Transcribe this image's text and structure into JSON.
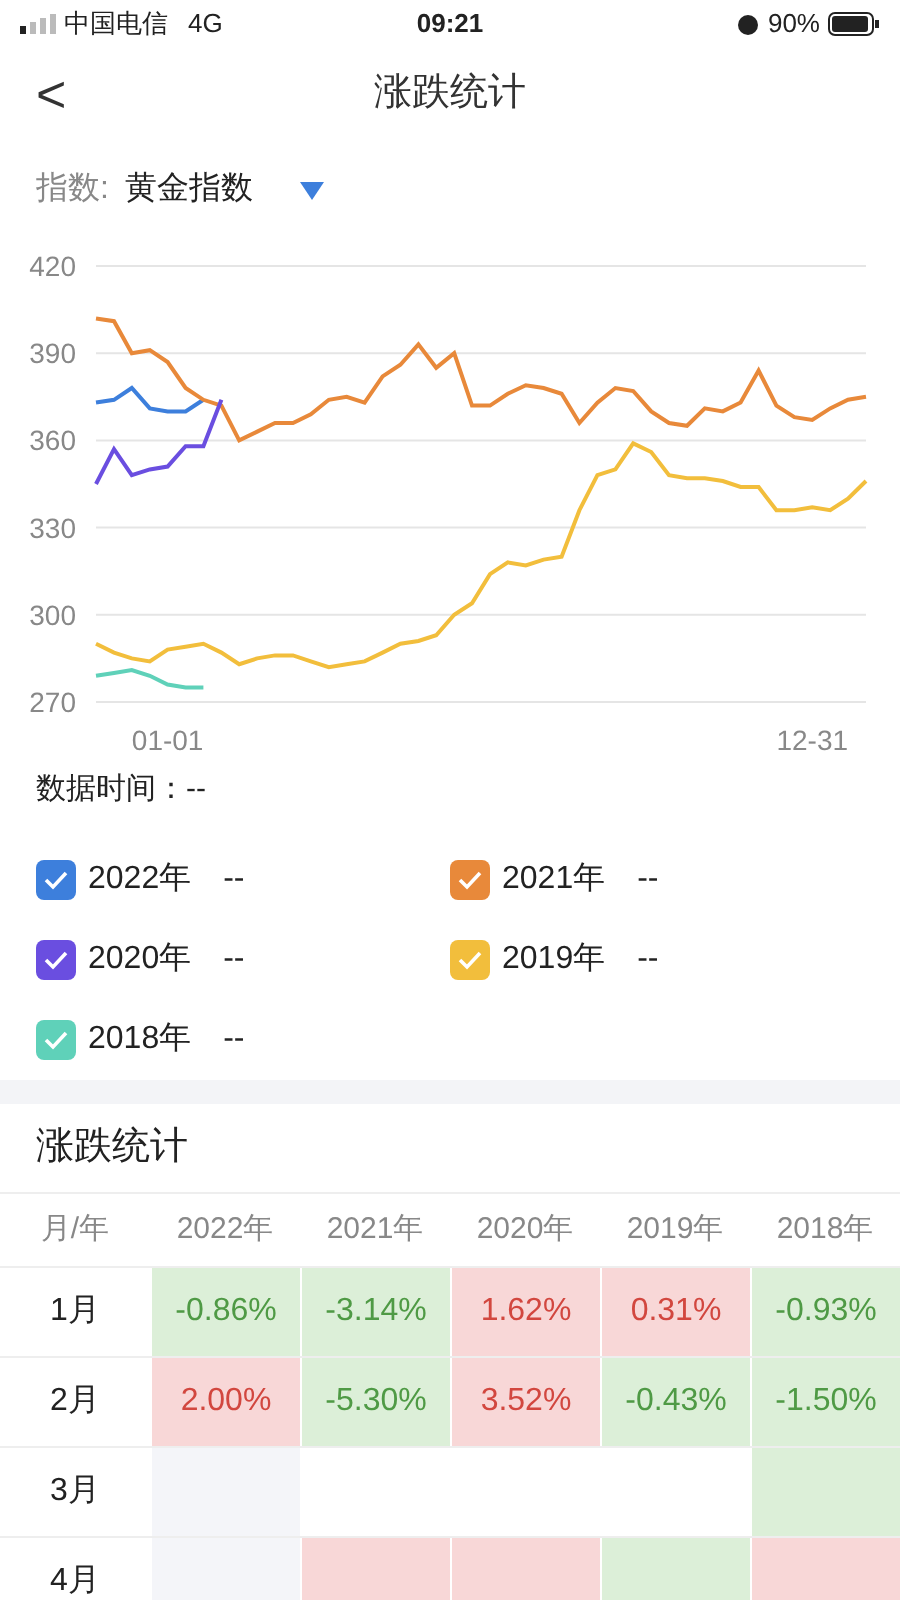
{
  "status_bar": {
    "carrier": "中国电信",
    "network": "4G",
    "time": "09:21",
    "battery": "90%"
  },
  "nav": {
    "back": "<",
    "title": "涨跌统计"
  },
  "index_picker": {
    "label": "指数:",
    "value": "黄金指数"
  },
  "chart_data": {
    "type": "line",
    "categories": [
      null,
      null,
      null,
      null,
      "01-01",
      null,
      null,
      null,
      null,
      null,
      null,
      null,
      null,
      null,
      null,
      null,
      null,
      null,
      null,
      null,
      null,
      null,
      null,
      null,
      null,
      null,
      null,
      null,
      null,
      null,
      null,
      null,
      null,
      null,
      null,
      null,
      null,
      null,
      null,
      null,
      "12-31",
      null,
      null,
      null
    ],
    "grid": true,
    "ylim": [
      270,
      420
    ],
    "yticks": [
      270,
      300,
      330,
      360,
      390,
      420
    ],
    "series": [
      {
        "name": "2022年",
        "color": "#3d7fdc",
        "values": [
          373,
          374,
          378,
          371,
          370,
          370,
          374,
          null,
          null,
          null,
          null,
          null,
          null,
          null,
          null,
          null,
          null,
          null,
          null,
          null,
          null,
          null,
          null,
          null,
          null,
          null,
          null,
          null,
          null,
          null,
          null,
          null,
          null,
          null,
          null,
          null,
          null,
          null,
          null,
          null,
          null,
          null,
          null,
          null
        ]
      },
      {
        "name": "2021年",
        "color": "#e8893a",
        "values": [
          402,
          401,
          390,
          391,
          387,
          378,
          374,
          372,
          360,
          363,
          366,
          366,
          369,
          374,
          375,
          373,
          382,
          386,
          393,
          385,
          390,
          372,
          372,
          376,
          379,
          378,
          376,
          366,
          373,
          378,
          377,
          370,
          366,
          365,
          371,
          370,
          373,
          384,
          372,
          368,
          367,
          371,
          374,
          375
        ]
      },
      {
        "name": "2020年",
        "color": "#6a4ee0",
        "values": [
          345,
          357,
          348,
          350,
          351,
          358,
          358,
          374,
          null,
          null,
          null,
          null,
          null,
          null,
          null,
          null,
          null,
          null,
          null,
          null,
          null,
          null,
          null,
          null,
          null,
          null,
          null,
          null,
          null,
          null,
          null,
          null,
          null,
          null,
          null,
          null,
          null,
          null,
          null,
          null,
          null,
          null,
          null,
          null
        ]
      },
      {
        "name": "2019年",
        "color": "#f2be3c",
        "values": [
          290,
          287,
          285,
          284,
          288,
          289,
          290,
          287,
          283,
          285,
          286,
          286,
          284,
          282,
          283,
          284,
          287,
          290,
          291,
          293,
          300,
          304,
          314,
          318,
          317,
          319,
          320,
          336,
          348,
          350,
          359,
          356,
          348,
          347,
          347,
          346,
          344,
          344,
          336,
          336,
          337,
          336,
          340,
          346
        ]
      },
      {
        "name": "2018年",
        "color": "#5fd1b9",
        "values": [
          279,
          280,
          281,
          279,
          276,
          275,
          275,
          null,
          null,
          null,
          null,
          null,
          null,
          null,
          null,
          null,
          null,
          null,
          null,
          null,
          null,
          null,
          null,
          null,
          null,
          null,
          null,
          null,
          null,
          null,
          null,
          null,
          null,
          null,
          null,
          null,
          null,
          null,
          null,
          null,
          null,
          null,
          null,
          null
        ]
      }
    ]
  },
  "data_time": {
    "label": "数据时间：",
    "value": "--"
  },
  "legend": [
    {
      "value": "--",
      "checked": true
    },
    {
      "value": "--",
      "checked": true
    },
    {
      "value": "--",
      "checked": true
    },
    {
      "value": "--",
      "checked": true
    },
    {
      "value": "--",
      "checked": true
    }
  ],
  "section_title": "涨跌统计",
  "table": {
    "columns": [
      "月/年",
      "2022年",
      "2021年",
      "2020年",
      "2019年",
      "2018年"
    ],
    "rows": [
      [
        {
          "kind": "month",
          "value": "1月"
        },
        {
          "kind": "fall",
          "value": "-0.86%"
        },
        {
          "kind": "fall",
          "value": "-3.14%"
        },
        {
          "kind": "rise",
          "value": "1.62%"
        },
        {
          "kind": "rise",
          "value": "0.31%"
        },
        {
          "kind": "fall",
          "value": "-0.93%"
        }
      ],
      [
        {
          "kind": "month",
          "value": "2月"
        },
        {
          "kind": "rise",
          "value": "2.00%"
        },
        {
          "kind": "fall",
          "value": "-5.30%"
        },
        {
          "kind": "rise",
          "value": "3.52%"
        },
        {
          "kind": "fall",
          "value": "-0.43%"
        },
        {
          "kind": "fall",
          "value": "-1.50%"
        }
      ],
      [
        {
          "kind": "month",
          "value": "3月"
        },
        {
          "kind": "empty"
        },
        {
          "kind": "blank"
        },
        {
          "kind": "blank"
        },
        {
          "kind": "blank"
        },
        {
          "kind": "fall"
        }
      ],
      [
        {
          "kind": "month",
          "value": "4月"
        },
        {
          "kind": "empty"
        },
        {
          "kind": "rise"
        },
        {
          "kind": "rise"
        },
        {
          "kind": "fall"
        },
        {
          "kind": "rise"
        }
      ]
    ]
  }
}
